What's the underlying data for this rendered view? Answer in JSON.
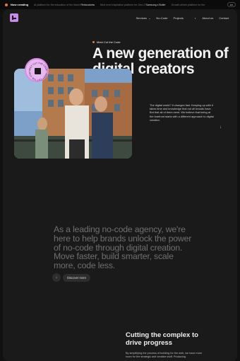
{
  "topbar": {
    "live_label": "Now creating",
    "items": [
      {
        "text": "AI platform for the education of the future",
        "client": "Reducatotra"
      },
      {
        "text": "Next level inspiration platform for Gen-Z",
        "client": "Samsung x Boiler"
      },
      {
        "text": "Growth-driven platform for the"
      }
    ],
    "language": "EN"
  },
  "nav": {
    "services": "Services",
    "nocode": "No-Code",
    "projects": "Projects",
    "about": "About us",
    "contact": "Contact"
  },
  "hero": {
    "kicker": "Meet Cut the Code",
    "headline": "A new generation of digital creators",
    "intro": "The digital world? It changes fast. Keeping up with it takes time and knowledge that not all brands have. But that all of them need. We believe that being at the forefront starts with a different approach to digital creation."
  },
  "statement": {
    "text": "As a leading no-code agency, we're here to help brands unlock the power of no-code through digital creation. Move faster, build smarter, scale more, code less.",
    "button": "Discover more"
  },
  "complex": {
    "heading": "Cutting the complex to drive progress",
    "body": "By simplifying the process of building for the web, we have more room for the strategic and creative stuff. Producing"
  },
  "colors": {
    "accent": "#f07a3a",
    "brand": "#c68be6",
    "badge": "#e9b7f0"
  }
}
